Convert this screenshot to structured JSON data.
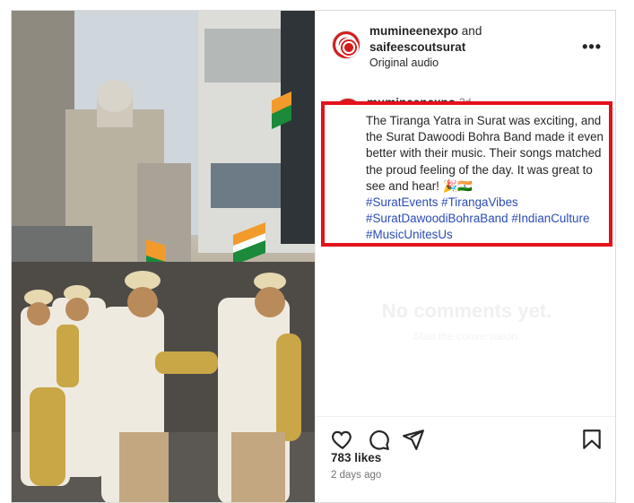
{
  "post": {
    "author_primary": "mumineenexpo",
    "joiner": "and",
    "author_secondary": "saifeescoutsurat",
    "audio": "Original audio",
    "more_label": "•••"
  },
  "comment": {
    "user": "mumineenexpo",
    "age": "2d",
    "text_intro": "The Tiranga Yatra in Surat was exciting, and the Surat Dawoodi Bohra Band made it even better with their music. Their songs matched the proud feeling of the day. It was great to see and hear! 🎉🇮🇳",
    "hashtags": [
      "#SuratEvents",
      "#TirangaVibes",
      "#SuratDawoodiBohraBand",
      "#IndianCulture",
      "#MusicUnitesUs"
    ]
  },
  "empty_state": {
    "title": "No comments yet.",
    "subtitle": "Start the conversation."
  },
  "stats": {
    "likes": "783 likes",
    "time": "2 days ago"
  },
  "icons": [
    "heart-icon",
    "comment-icon",
    "share-icon",
    "bookmark-icon",
    "more-icon"
  ],
  "colors": {
    "highlight": "#e4121b",
    "hashtag": "#2b4bb8",
    "text": "#262626",
    "muted": "#737373"
  }
}
